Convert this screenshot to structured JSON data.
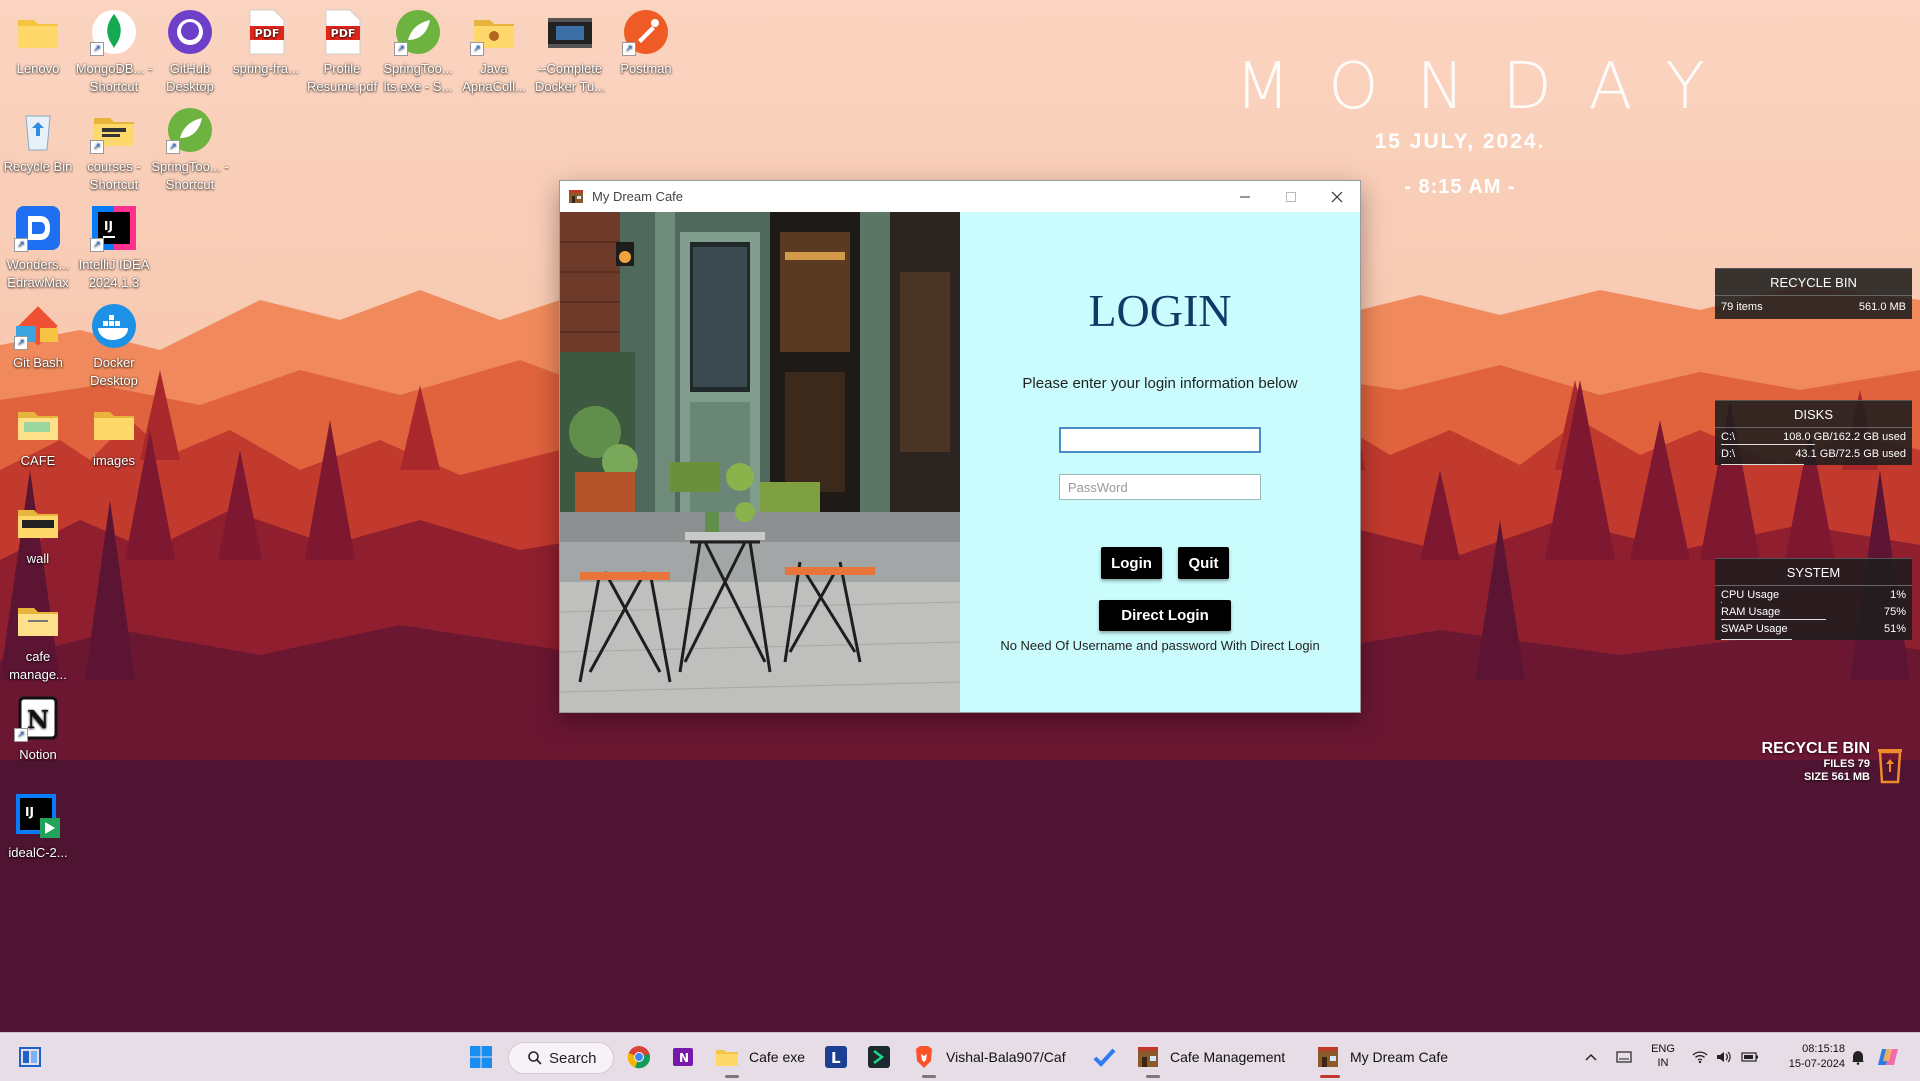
{
  "desktop": {
    "icons": [
      {
        "label": "Lenovo"
      },
      {
        "label": "MongoDB... - Shortcut"
      },
      {
        "label": "GitHub Desktop"
      },
      {
        "label": "spring-fra..."
      },
      {
        "label": "Profile Resume.pdf"
      },
      {
        "label": "SpringToo... lts.exe - S..."
      },
      {
        "label": "Java ApnaColl..."
      },
      {
        "label": "--Complete Docker Tu..."
      },
      {
        "label": "Postman"
      },
      {
        "label": "Recycle Bin"
      },
      {
        "label": "courses - Shortcut"
      },
      {
        "label": "SpringToo... - Shortcut"
      },
      {
        "label": "Wonders... EdrawMax"
      },
      {
        "label": "IntelliJ IDEA 2024.1.3"
      },
      {
        "label": "Git Bash"
      },
      {
        "label": "Docker Desktop"
      },
      {
        "label": "CAFE"
      },
      {
        "label": "images"
      },
      {
        "label": "wall"
      },
      {
        "label": "cafe manage..."
      },
      {
        "label": "Notion"
      },
      {
        "label": "idealC-2..."
      }
    ]
  },
  "clock_widget": {
    "day": "MONDAY",
    "date": "15 JULY, 2024.",
    "time": "- 8:15 AM -"
  },
  "panels": {
    "recycle": {
      "title": "RECYCLE BIN",
      "items_label": "79 items",
      "size": "561.0 MB"
    },
    "disks": {
      "title": "DISKS",
      "rows": [
        {
          "drive": "C:\\",
          "usage": "108.0 GB/162.2 GB used",
          "fill": 0.67
        },
        {
          "drive": "D:\\",
          "usage": "43.1 GB/72.5 GB used",
          "fill": 0.59
        }
      ]
    },
    "system": {
      "title": "SYSTEM",
      "rows": [
        {
          "label": "CPU Usage",
          "value": "1%",
          "fill": 0.01
        },
        {
          "label": "RAM Usage",
          "value": "75%",
          "fill": 0.75
        },
        {
          "label": "SWAP Usage",
          "value": "51%",
          "fill": 0.51
        }
      ]
    }
  },
  "recycle_badge": {
    "title": "RECYCLE BIN",
    "files": "FILES 79",
    "size": "SIZE 561 MB"
  },
  "app": {
    "window_title": "My Dream Cafe",
    "heading": "LOGIN",
    "subtitle": "Please enter your login information below",
    "username_value": "",
    "password_placeholder": "PassWord",
    "login_button": "Login",
    "quit_button": "Quit",
    "direct_login_button": "Direct Login",
    "direct_note": "No Need Of Username and password With Direct Login"
  },
  "taskbar": {
    "search_label": "Search",
    "items": [
      {
        "label": "Cafe exe"
      },
      {
        "label": "Vishal-Bala907/Caf"
      },
      {
        "label": "Cafe Management"
      },
      {
        "label": "My Dream Cafe"
      }
    ],
    "lang_top": "ENG",
    "lang_bottom": "IN",
    "time": "08:15:18",
    "date": "15-07-2024"
  }
}
